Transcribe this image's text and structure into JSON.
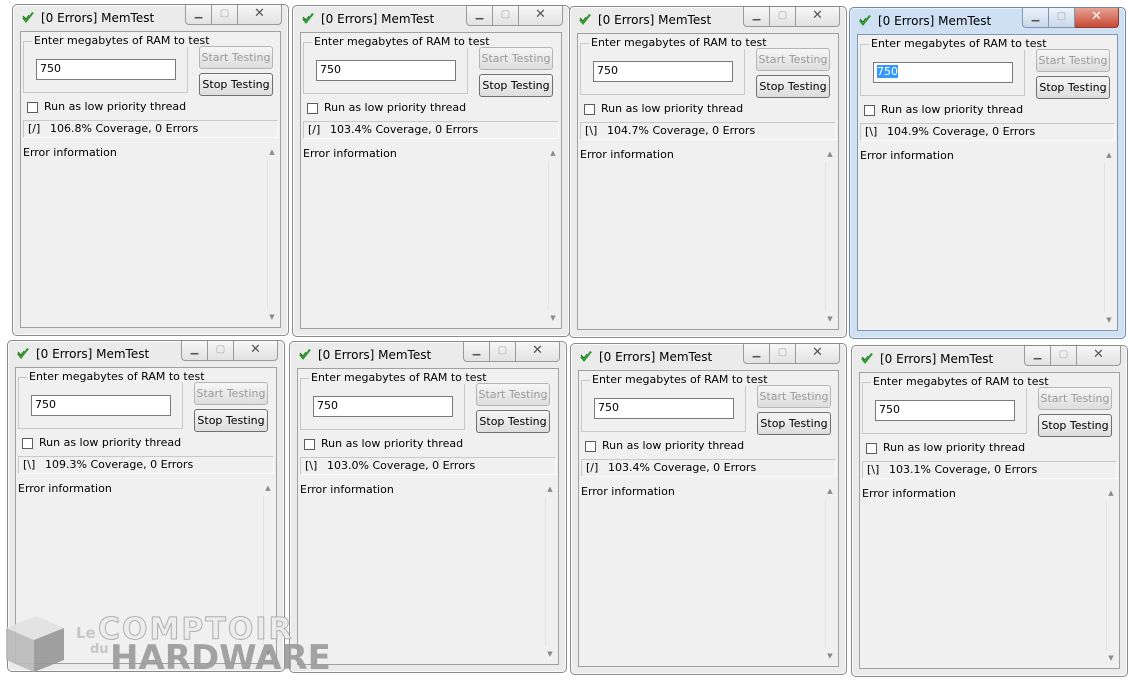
{
  "app": {
    "title": "[0 Errors] MemTest",
    "group_label": "Enter megabytes of RAM to test",
    "start_label": "Start Testing",
    "stop_label": "Stop Testing",
    "checkbox_label": "Run as low priority thread",
    "error_title": "Error information",
    "minimize_glyph": "▁",
    "maximize_glyph": "▢",
    "close_glyph": "✕",
    "scroll_up_glyph": "▲",
    "scroll_down_glyph": "▼"
  },
  "windows": [
    {
      "ram": "750",
      "spinner": "[/]",
      "coverage": "106.8% Coverage, 0 Errors",
      "active": false
    },
    {
      "ram": "750",
      "spinner": "[/]",
      "coverage": "103.4% Coverage, 0 Errors",
      "active": false
    },
    {
      "ram": "750",
      "spinner": "[\\]",
      "coverage": "104.7% Coverage, 0 Errors",
      "active": false
    },
    {
      "ram": "750",
      "spinner": "[\\]",
      "coverage": "104.9% Coverage, 0 Errors",
      "active": true
    },
    {
      "ram": "750",
      "spinner": "[\\]",
      "coverage": "109.3% Coverage, 0 Errors",
      "active": false
    },
    {
      "ram": "750",
      "spinner": "[\\]",
      "coverage": "103.0% Coverage, 0 Errors",
      "active": false
    },
    {
      "ram": "750",
      "spinner": "[/]",
      "coverage": "103.4% Coverage, 0 Errors",
      "active": false
    },
    {
      "ram": "750",
      "spinner": "[\\]",
      "coverage": "103.1% Coverage, 0 Errors",
      "active": false
    }
  ],
  "watermark": {
    "le": "Le",
    "du": "du",
    "comptoir": "COMPTOIR",
    "hardware": "HARDWARE"
  },
  "colors": {
    "active_frame": "#cfe0f3",
    "inactive_frame": "#ebebeb",
    "selection": "#3399ff",
    "icon_green": "#2e9a2e"
  }
}
